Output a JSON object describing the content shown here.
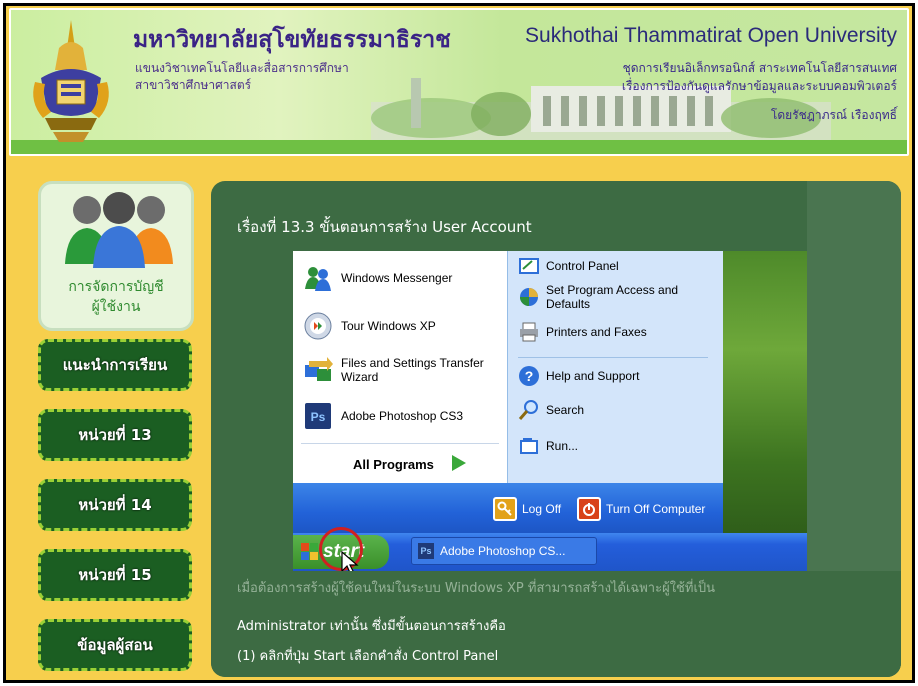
{
  "header": {
    "title_th": "มหาวิทยาลัยสุโขทัยธรรมาธิราช",
    "subtitle_th_1": "แขนงวิชาเทคโนโลยีและสื่อสารการศึกษา",
    "subtitle_th_2": "สาขาวิชาศึกษาศาสตร์",
    "title_en": "Sukhothai Thammatirat Open University",
    "course_line_1": "ชุดการเรียนอิเล็กทรอนิกส์ สาระเทคโนโลยีสารสนเทศ",
    "course_line_2": "เรื่องการป้องกันดูแลรักษาข้อมูลและระบบคอมพิวเตอร์",
    "author": "โดยรัชฎาภรณ์ เรืองฤทธิ์"
  },
  "sidebar": {
    "profile_label_1": "การจัดการบัญชี",
    "profile_label_2": "ผู้ใช้งาน",
    "buttons": [
      {
        "label": "แนะนำการเรียน"
      },
      {
        "label": "หน่วยที่ 13"
      },
      {
        "label": "หน่วยที่ 14"
      },
      {
        "label": "หน่วยที่ 15"
      },
      {
        "label": "ข้อมูลผู้สอน"
      }
    ]
  },
  "panel": {
    "title": "เรื่องที่ 13.3 ขั้นตอนการสร้าง User Account"
  },
  "start_menu": {
    "left_items": [
      {
        "label": "Windows Messenger",
        "icon": "messenger-icon"
      },
      {
        "label": "Tour Windows XP",
        "icon": "tour-icon"
      },
      {
        "label": "Files and Settings Transfer",
        "label2": "Wizard",
        "icon": "transfer-wizard-icon"
      },
      {
        "label": "Adobe Photoshop CS3",
        "icon": "photoshop-icon"
      }
    ],
    "all_programs": "All Programs",
    "right_items": [
      {
        "label": "Control Panel"
      },
      {
        "label": "Set Program Access and",
        "label2": "Defaults"
      },
      {
        "label": "Printers and Faxes"
      },
      {
        "label": "Help and Support"
      },
      {
        "label": "Search"
      },
      {
        "label": "Run..."
      }
    ],
    "log_off": "Log Off",
    "turn_off": "Turn Off Computer"
  },
  "taskbar": {
    "start_label": "start",
    "task_label": "Adobe Photoshop CS...",
    "task_icon_text": "Ps"
  },
  "description": {
    "line_1": "เมื่อต้องการสร้างผู้ใช้คนใหม่ในระบบ Windows XP ที่สามารถสร้างได้เฉพาะผู้ใช้ที่เป็น",
    "line_2": "Administrator เท่านั้น ซึ่งมีขั้นตอนการสร้างคือ",
    "line_3": "(1) คลิกที่ปุ่ม Start เลือกคำสั่ง Control Panel"
  },
  "colors": {
    "frame_bg": "#f7cf4d",
    "panel_bg": "#3d6b43",
    "nav_bg": "#1b5e22",
    "nav_border": "#9ad135",
    "xp_blue": "#245edb",
    "xp_green": "#3a8f2a"
  }
}
